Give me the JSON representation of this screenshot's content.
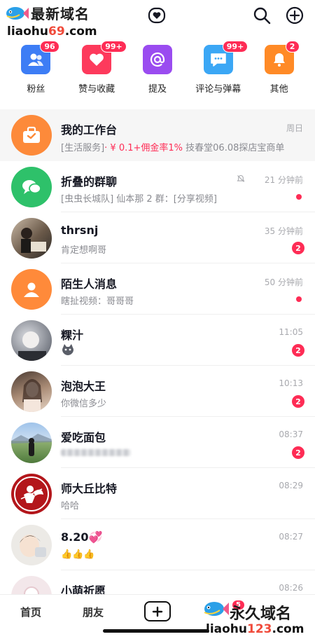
{
  "watermark_top": {
    "title": "最新域名",
    "url_pre": "liaohu",
    "url_num": "69",
    "url_post": ".com"
  },
  "watermark_bottom": {
    "title": "永久域名",
    "url_pre": "liaohu",
    "url_num": "123",
    "url_post": ".com"
  },
  "categories": [
    {
      "label": "粉丝",
      "badge": "96",
      "color": "#3d7df5",
      "icon": "fans-icon"
    },
    {
      "label": "赞与收藏",
      "badge": "99+",
      "color": "#fd3a5c",
      "icon": "heart-icon"
    },
    {
      "label": "提及",
      "badge": "",
      "color": "#9a4cf0",
      "icon": "at-icon"
    },
    {
      "label": "评论与弹幕",
      "badge": "99+",
      "color": "#3ba7f5",
      "icon": "comment-icon"
    },
    {
      "label": "其他",
      "badge": "2",
      "color": "#ff8a26",
      "icon": "bell-icon"
    }
  ],
  "messages": [
    {
      "name": "我的工作台",
      "sub_tag": "[生活服务]",
      "sub_highlight": "· ¥ 0.1+佣金率1%",
      "sub_rest": " 技春堂06.08探店宝商单",
      "time": "周日",
      "indicator": "none",
      "count": ""
    },
    {
      "name": "折叠的群聊",
      "sub": "[虫虫长城队] 仙本那 2 群：[分享视频]",
      "time": "21 分钟前",
      "indicator": "dot",
      "count": "",
      "muted_icon": "bell-off-icon"
    },
    {
      "name": "thrsnj",
      "sub": "肯定想啊哥",
      "time": "35 分钟前",
      "indicator": "count",
      "count": "2"
    },
    {
      "name": "陌生人消息",
      "sub": "瞎扯视频：哥哥哥",
      "time": "50 分钟前",
      "indicator": "dot",
      "count": ""
    },
    {
      "name": "粿汁",
      "sub": "",
      "time": "11:05",
      "indicator": "count",
      "count": "2",
      "sub_icon": "cat-emoji-icon"
    },
    {
      "name": "泡泡大王",
      "sub": "你微信多少",
      "time": "10:13",
      "indicator": "count",
      "count": "2"
    },
    {
      "name": "爱吃面包",
      "sub": "",
      "time": "08:37",
      "indicator": "count",
      "count": "2",
      "sub_icon": "blurred-text"
    },
    {
      "name": "师大丘比特",
      "sub": "哈哈",
      "time": "08:29",
      "indicator": "none",
      "count": ""
    },
    {
      "name": "8.20💞",
      "sub": "👍👍👍",
      "time": "08:27",
      "indicator": "none",
      "count": ""
    },
    {
      "name": "小萌祈愿",
      "sub": "",
      "time": "08:26",
      "indicator": "none",
      "count": ""
    }
  ],
  "bottom_nav": {
    "home": "首页",
    "friends": "朋友",
    "badge": "5"
  }
}
